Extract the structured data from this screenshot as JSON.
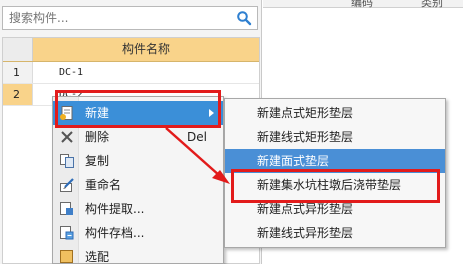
{
  "search": {
    "placeholder": "搜索构件..."
  },
  "table": {
    "header_name": "构件名称",
    "rows": [
      {
        "num": "1",
        "name": "DC-1"
      },
      {
        "num": "2",
        "name": "DC-2"
      }
    ]
  },
  "right_panel": {
    "col1": "编码",
    "col2": "类别"
  },
  "context_menu": {
    "items": [
      {
        "label": "新建",
        "icon": "new-icon",
        "has_submenu": true
      },
      {
        "label": "删除",
        "shortcut": "Del",
        "icon": "delete-x-icon"
      },
      {
        "label": "复制",
        "icon": "copy-icon"
      },
      {
        "label": "重命名",
        "icon": "rename-icon"
      },
      {
        "label": "构件提取...",
        "icon": "extract-icon"
      },
      {
        "label": "构件存档...",
        "icon": "archive-icon"
      },
      {
        "label": "选配",
        "icon": "select-icon"
      }
    ]
  },
  "submenu": {
    "items": [
      {
        "label": "新建点式矩形垫层"
      },
      {
        "label": "新建线式矩形垫层"
      },
      {
        "label": "新建面式垫层"
      },
      {
        "label": "新建集水坑柱墩后浇带垫层"
      },
      {
        "label": "新建点式异形垫层"
      },
      {
        "label": "新建线式异形垫层"
      }
    ]
  },
  "colors": {
    "accent_highlight": "#3b8fd8",
    "annotation_red": "#e21b1b",
    "header_orange": "#f9d38a"
  }
}
